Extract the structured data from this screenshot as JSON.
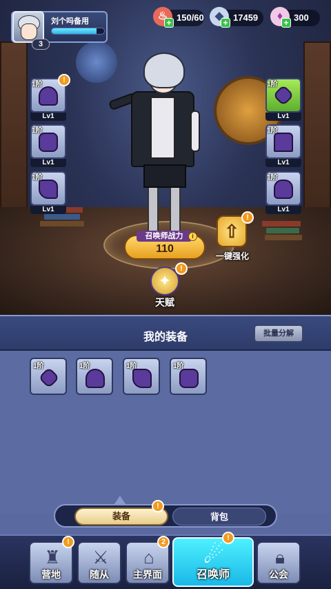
{
  "player": {
    "name": "刘个吗备用",
    "level": "3",
    "exp_fraction": 0.85
  },
  "resources": [
    {
      "icon": "meat-icon",
      "value": "150/60"
    },
    {
      "icon": "diamond-icon",
      "value": "17459"
    },
    {
      "icon": "gem-icon",
      "value": "300"
    }
  ],
  "equipped_left": [
    {
      "tier": "1阶",
      "level": "Lv1",
      "icon": "hood-helmet-icon",
      "alert": "!"
    },
    {
      "tier": "1阶",
      "level": "Lv1",
      "icon": "armor-icon"
    },
    {
      "tier": "1阶",
      "level": "Lv1",
      "icon": "boots-icon"
    }
  ],
  "equipped_right": [
    {
      "tier": "1阶",
      "level": "Lv1",
      "icon": "amulet-icon"
    },
    {
      "tier": "1阶",
      "level": "Lv1",
      "icon": "pants-icon"
    },
    {
      "tier": "1阶",
      "level": "Lv1",
      "icon": "gloves-icon"
    }
  ],
  "power": {
    "label": "召唤师战力",
    "value": "110",
    "info": "i"
  },
  "upgrade_button": {
    "label": "一键强化",
    "alert": "!"
  },
  "talent_button": {
    "label": "天赋",
    "alert": "!"
  },
  "inventory": {
    "title": "我的装备",
    "batch_button": "批量分解",
    "items": [
      {
        "tier": "1阶",
        "icon": "amulet-icon"
      },
      {
        "tier": "1阶",
        "icon": "hood-helmet-icon"
      },
      {
        "tier": "1阶",
        "icon": "boots-icon"
      },
      {
        "tier": "1阶",
        "icon": "armor-icon"
      }
    ]
  },
  "tabs": {
    "active": "装备",
    "inactive": "背包",
    "alert": "!"
  },
  "nav": [
    {
      "label": "营地",
      "icon": "castle-icon",
      "badge": "!"
    },
    {
      "label": "随从",
      "icon": "sword-icon"
    },
    {
      "label": "主界面",
      "icon": "home-icon",
      "badge": "2"
    },
    {
      "label": "召唤师",
      "icon": "summoner-icon",
      "badge": "!"
    },
    {
      "label": "公会",
      "icon": "lock-icon"
    }
  ],
  "colors": {
    "accent_cyan": "#2fd6f0",
    "alert_orange": "#f29a1e",
    "panel_blue": "#5c6ca2",
    "gold": "#e8a020"
  }
}
